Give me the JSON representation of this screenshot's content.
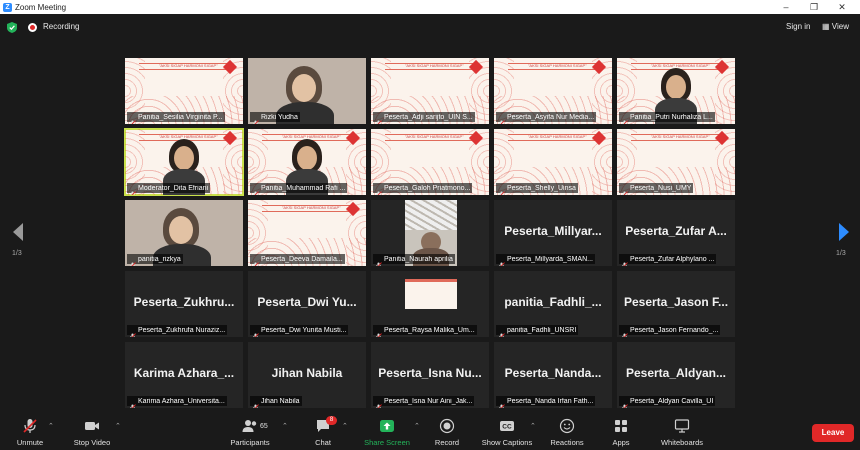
{
  "window": {
    "title": "Zoom Meeting",
    "logo": "Z",
    "controls": [
      "minimize-icon",
      "restore-icon",
      "close-icon"
    ]
  },
  "topbar": {
    "recording_label": "Recording",
    "sign_in": "Sign in",
    "view": "View"
  },
  "nav": {
    "prev_page": "1/3",
    "next_page": "1/3"
  },
  "slide": {
    "banner_text": "\"AKSI SIGAP HARMONI SIGAP\""
  },
  "participants": [
    {
      "label": "Panitia_Sesilia Virginita P...",
      "type": "slide"
    },
    {
      "label": "Rizki Yudha",
      "type": "video"
    },
    {
      "label": "Peserta_Adji sarijto_UIN S...",
      "type": "slide"
    },
    {
      "label": "Peserta_Asyifa Nur Media...",
      "type": "slide"
    },
    {
      "label": "Panitia_Putri Nurhaliza L...",
      "type": "slide-video"
    },
    {
      "label": "Moderator_Dita Efriani",
      "type": "slide-video",
      "highlight": true
    },
    {
      "label": "Panitia_Muhammad Rafi ...",
      "type": "slide-video"
    },
    {
      "label": "Peserta_Galoh Priatmono...",
      "type": "slide"
    },
    {
      "label": "Peserta_Shelly_Uinsa",
      "type": "slide"
    },
    {
      "label": "Peserta_Nusi_UMY",
      "type": "slide"
    },
    {
      "label": "panitia_rizkya",
      "type": "video"
    },
    {
      "label": "Peserta_Deeva Damaila...",
      "type": "slide"
    },
    {
      "label": "Panitia_Naurah aprilia",
      "type": "video-dark"
    },
    {
      "label": "Peserta_Millyarda_SMAN...",
      "type": "name",
      "big": "Peserta_Millyar..."
    },
    {
      "label": "Peserta_Zufar Alphylano ...",
      "type": "name",
      "big": "Peserta_Zufar A..."
    },
    {
      "label": "Peserta_Zukhrufa Nuraziz...",
      "type": "name",
      "big": "Peserta_Zukhru..."
    },
    {
      "label": "Peserta_Dwi Yunita Musti...",
      "type": "name",
      "big": "Peserta_Dwi Yu..."
    },
    {
      "label": "Peserta_Raysa Malika_Um...",
      "type": "mini-slide"
    },
    {
      "label": "panitia_Fadhli_UNSRI",
      "type": "name",
      "big": "panitia_Fadhli_..."
    },
    {
      "label": "Peserta_Jason Fernando_...",
      "type": "name",
      "big": "Peserta_Jason F..."
    },
    {
      "label": "Karima Azhara_Universita...",
      "type": "name",
      "big": "Karima Azhara_..."
    },
    {
      "label": "Jihan Nabila",
      "type": "name",
      "big": "Jihan Nabila"
    },
    {
      "label": "Peserta_Isna Nur Aini_Jak...",
      "type": "name",
      "big": "Peserta_Isna Nu..."
    },
    {
      "label": "Peserta_Nanda Irfan Fath...",
      "type": "name",
      "big": "Peserta_Nanda..."
    },
    {
      "label": "Peserta_Aldyan Cavilla_UI",
      "type": "name",
      "big": "Peserta_Aldyan..."
    }
  ],
  "toolbar": {
    "unmute": "Unmute",
    "stop_video": "Stop Video",
    "participants": "Participants",
    "participants_count": "65",
    "chat": "Chat",
    "chat_badge": "8",
    "share_screen": "Share Screen",
    "record": "Record",
    "show_captions": "Show Captions",
    "reactions": "Reactions",
    "apps": "Apps",
    "whiteboards": "Whiteboards",
    "leave": "Leave"
  },
  "colors": {
    "accent_blue": "#2d8cff",
    "leave_red": "#e02828",
    "share_green": "#23b35a",
    "active_speaker": "#c8e04a"
  }
}
